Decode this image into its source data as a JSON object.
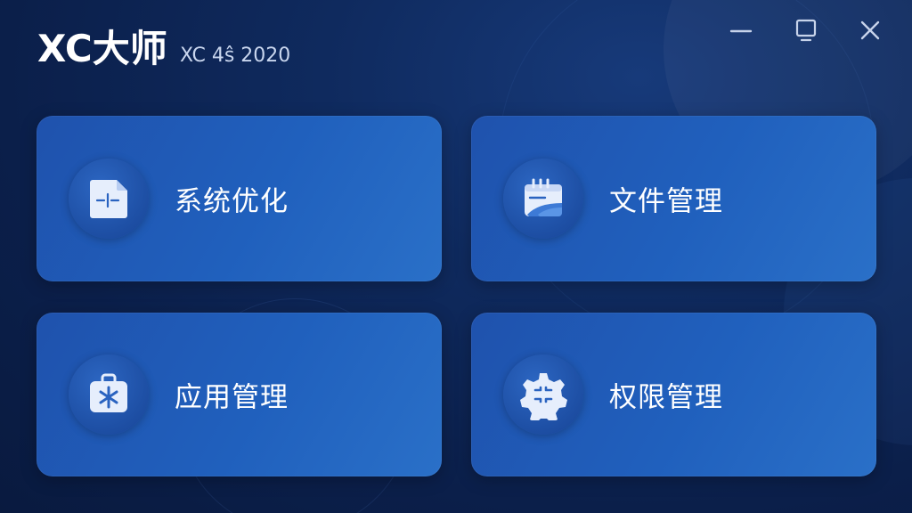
{
  "header": {
    "title": "XC大师",
    "version": "XC 4ŝ 2020"
  },
  "window_controls": {
    "minimize_icon": "minimize-icon",
    "maximize_icon": "maximize-icon",
    "close_icon": "close-icon"
  },
  "cards": [
    {
      "label": "系统优化",
      "icon": "document-tune-icon"
    },
    {
      "label": "文件管理",
      "icon": "calendar-folder-icon"
    },
    {
      "label": "应用管理",
      "icon": "toolbox-icon"
    },
    {
      "label": "权限管理",
      "icon": "gear-icon"
    }
  ],
  "colors": {
    "background": "#0b1f4a",
    "card": "#2060bd",
    "icon_circle": "#1d4ea3",
    "icon_fill": "#e6eefc",
    "text": "#ffffff"
  }
}
